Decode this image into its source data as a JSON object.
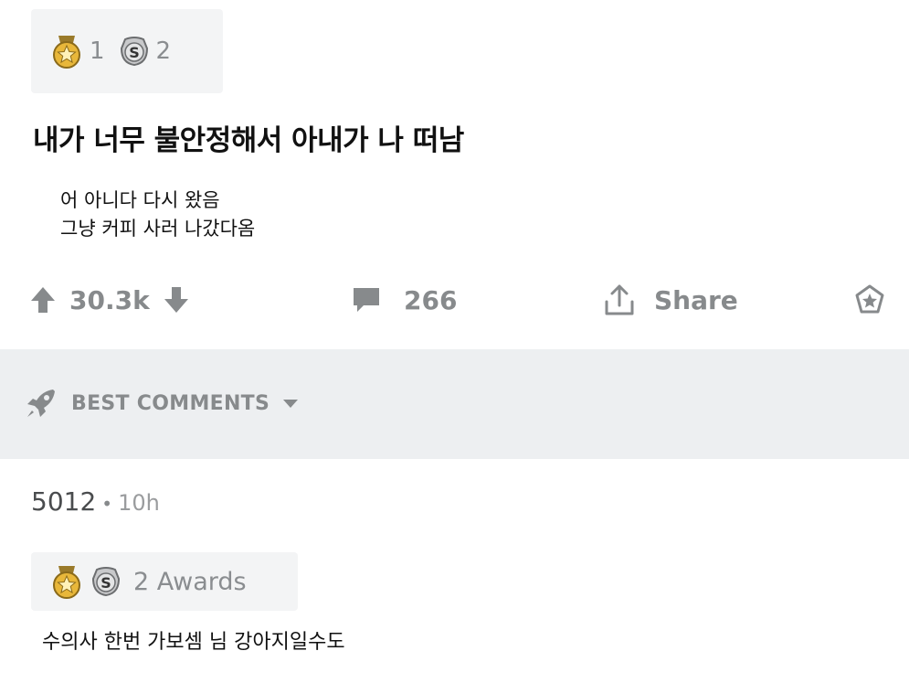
{
  "post": {
    "awards": {
      "gold_count": "1",
      "silver_count": "2"
    },
    "title": "내가 너무 불안정해서 아내가 나 떠남",
    "body_lines": [
      "어 아니다 다시 왔음",
      "그냥 커피 사러 나갔다옴"
    ]
  },
  "actions": {
    "score": "30.3k",
    "comments_count": "266",
    "share_label": "Share"
  },
  "best_comments": {
    "label": "BEST COMMENTS"
  },
  "comment": {
    "user": "5012",
    "separator": "•",
    "time": "10h",
    "awards_label": "2 Awards",
    "text": "수의사 한번 가보셈 님 강아지일수도"
  },
  "colors": {
    "gold": "#e8b73a",
    "muted": "#878a8c",
    "band": "#edeff1"
  }
}
